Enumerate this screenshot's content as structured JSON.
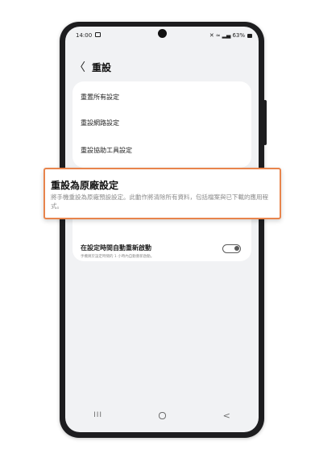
{
  "status_bar": {
    "time": "14:00",
    "signal_text": "⚡≈ .ill .il 63%",
    "icons": [
      "image-icon",
      "mute-icon",
      "wifi-icon",
      "signal-icon",
      "battery-icon"
    ],
    "battery_percent": "63%"
  },
  "header": {
    "back_glyph": "〈",
    "title": "重設"
  },
  "reset_list": {
    "items": [
      {
        "label": "重置所有設定"
      },
      {
        "label": "重設網路設定"
      },
      {
        "label": "重設協助工具設定"
      }
    ]
  },
  "factory_reset": {
    "title": "重設為原廠設定",
    "description": "將手機重設為原廠預設設定。此動作將清除所有資料，包括檔案與已下載的應用程式。"
  },
  "auto_restart": {
    "title": "在設定時間自動重新啟動",
    "description": "手機將於設定時間的 1 小時內自動重新啟動。",
    "toggle_on": false
  },
  "nav_bar": {
    "recent_glyph": "III",
    "back_glyph": "<"
  },
  "colors": {
    "highlight_border": "#e8844c",
    "screen_bg": "#f1f2f4",
    "card_bg": "#ffffff",
    "frame": "#1d1d1f"
  }
}
